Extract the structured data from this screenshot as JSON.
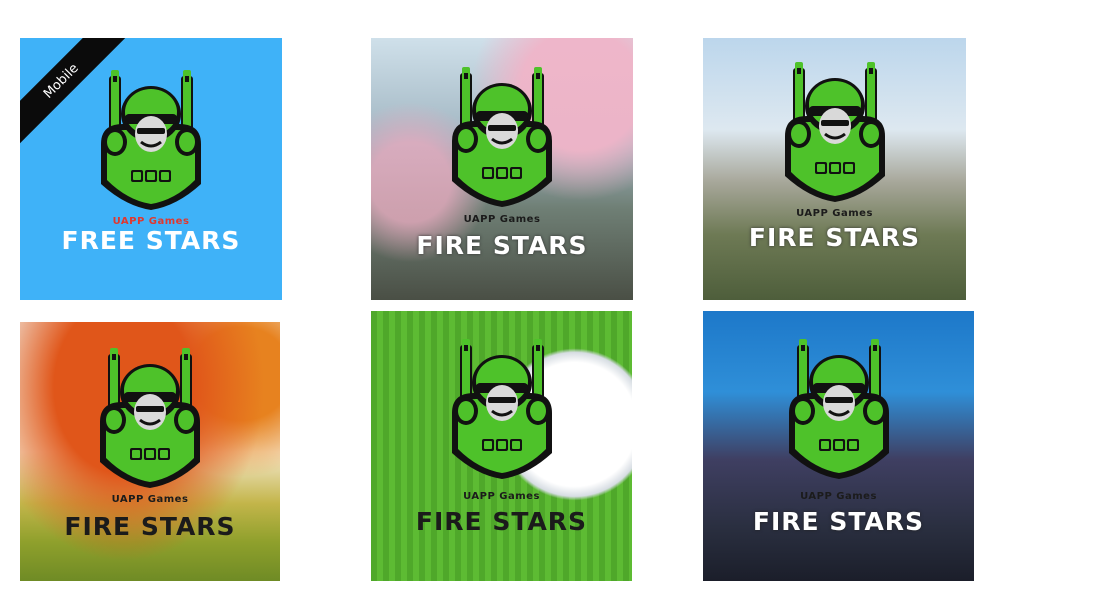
{
  "tiles": [
    {
      "brand": "UAPP Games",
      "title": "FREE STARS",
      "ribbon": "Mobile"
    },
    {
      "brand": "UAPP Games",
      "title": "FIRE STARS"
    },
    {
      "brand": "UAPP Games",
      "title": "FIRE STARS"
    },
    {
      "brand": "UAPP Games",
      "title": "FIRE STARS"
    },
    {
      "brand": "UAPP Games",
      "title": "FIRE STARS"
    },
    {
      "brand": "UAPP Games",
      "title": "FIRE STARS"
    }
  ],
  "colors": {
    "mascot_green": "#4ec22a",
    "mascot_dark": "#111111",
    "brand_red": "#e0382f",
    "tile1_bg": "#3fb2f8"
  },
  "icons": {
    "mascot": "soldier-mascot-icon"
  }
}
